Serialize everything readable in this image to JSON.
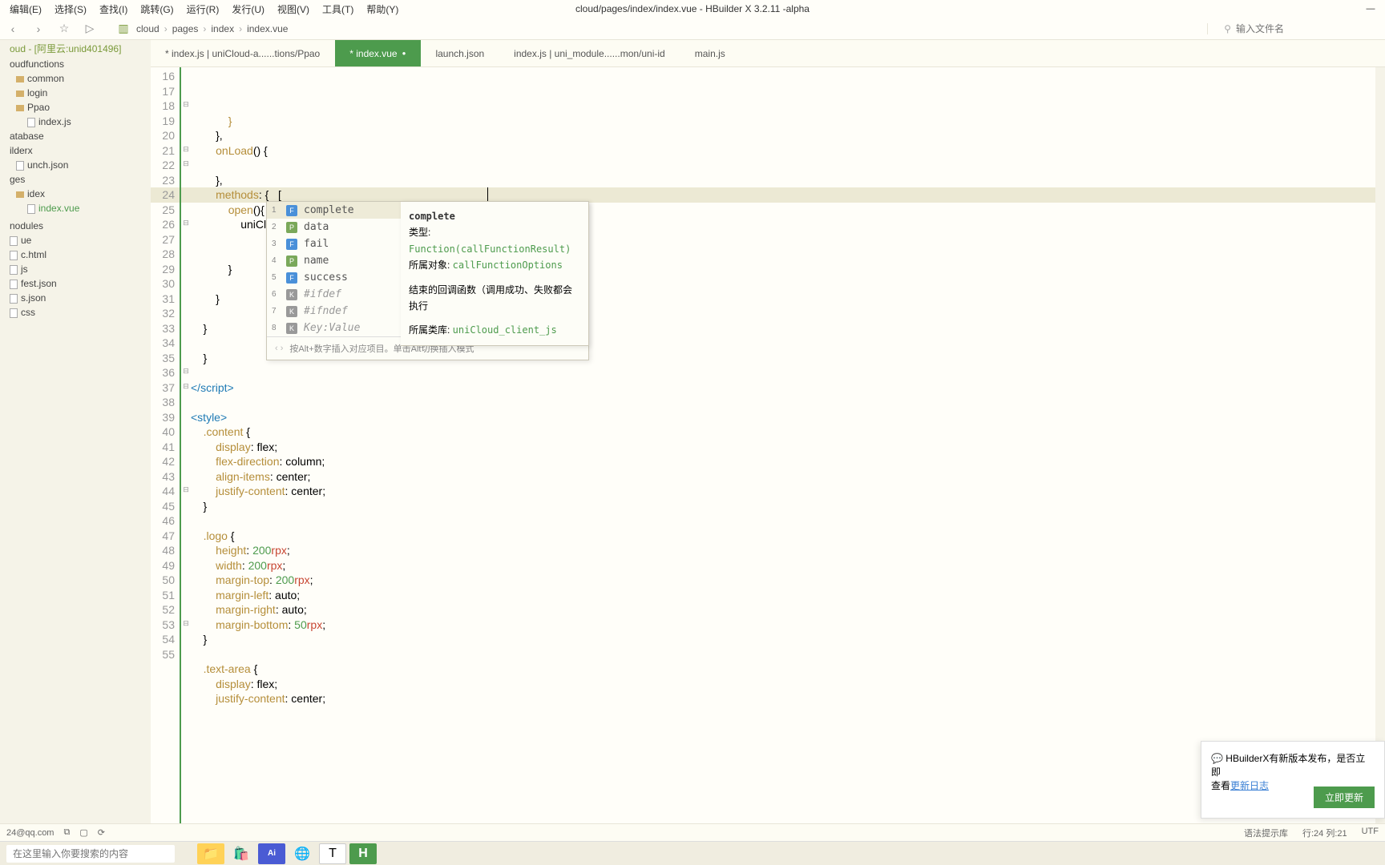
{
  "window": {
    "title": "cloud/pages/index/index.vue - HBuilder X 3.2.11 -alpha"
  },
  "menu": [
    "编辑(E)",
    "选择(S)",
    "查找(I)",
    "跳转(G)",
    "运行(R)",
    "发行(U)",
    "视图(V)",
    "工具(T)",
    "帮助(Y)"
  ],
  "search": {
    "placeholder": "输入文件名"
  },
  "breadcrumb": [
    "cloud",
    "pages",
    "index",
    "index.vue"
  ],
  "tabs": [
    {
      "label": "* index.js | uniCloud-a......tions/Ppao",
      "active": false
    },
    {
      "label": "* index.vue",
      "active": true
    },
    {
      "label": "launch.json",
      "active": false
    },
    {
      "label": "index.js | uni_module......mon/uni-id",
      "active": false
    },
    {
      "label": "main.js",
      "active": false
    }
  ],
  "sidebar": [
    {
      "label": "oud - [阿里云:unid401496]",
      "lvl": 0,
      "cls": "green"
    },
    {
      "label": "oudfunctions",
      "lvl": 0
    },
    {
      "label": "common",
      "lvl": 1,
      "icon": "folder"
    },
    {
      "label": "login",
      "lvl": 1,
      "icon": "folder"
    },
    {
      "label": "Ppao",
      "lvl": 1,
      "icon": "folder"
    },
    {
      "label": "index.js",
      "lvl": 2,
      "icon": "file"
    },
    {
      "label": "atabase",
      "lvl": 0
    },
    {
      "label": "ilderx",
      "lvl": 0
    },
    {
      "label": "unch.json",
      "lvl": 1,
      "icon": "file"
    },
    {
      "label": "ges",
      "lvl": 0
    },
    {
      "label": "idex",
      "lvl": 1,
      "icon": "folder"
    },
    {
      "label": "index.vue",
      "lvl": 2,
      "icon": "file",
      "cls": "selected"
    },
    {
      "label": "",
      "lvl": 0
    },
    {
      "label": "nodules",
      "lvl": 0
    },
    {
      "label": "ue",
      "lvl": 0,
      "icon": "file"
    },
    {
      "label": "c.html",
      "lvl": 0,
      "icon": "file"
    },
    {
      "label": "js",
      "lvl": 0,
      "icon": "file"
    },
    {
      "label": "fest.json",
      "lvl": 0,
      "icon": "file"
    },
    {
      "label": "s.json",
      "lvl": 0,
      "icon": "file"
    },
    {
      "label": "css",
      "lvl": 0,
      "icon": "file"
    }
  ],
  "code_lines": [
    {
      "n": 16,
      "html": "            <span class='c-brace1'>}</span>"
    },
    {
      "n": 17,
      "html": "        },"
    },
    {
      "n": 18,
      "html": "        <span class='c-func'>onLoad</span>() {",
      "fold": "⊟"
    },
    {
      "n": 19,
      "html": ""
    },
    {
      "n": 20,
      "html": "        },"
    },
    {
      "n": 21,
      "html": "        <span class='c-func'>methods</span>: {   <span style='color:#000'>[</span>",
      "fold": "⊟"
    },
    {
      "n": 22,
      "html": "            <span class='c-func'>open</span>(){",
      "fold": "⊟"
    },
    {
      "n": 23,
      "html": "                uniCloud.<span class='c-func'>callFunction</span>({"
    },
    {
      "n": 24,
      "html": "                    ",
      "hl": true
    },
    {
      "n": 25,
      "html": ""
    },
    {
      "n": 26,
      "html": "            }",
      "fold": "⊟"
    },
    {
      "n": 27,
      "html": ""
    },
    {
      "n": 28,
      "html": "        }"
    },
    {
      "n": 29,
      "html": ""
    },
    {
      "n": 30,
      "html": "    }"
    },
    {
      "n": 31,
      "html": ""
    },
    {
      "n": 32,
      "html": "    }"
    },
    {
      "n": 33,
      "html": ""
    },
    {
      "n": 34,
      "html": "<span class='c-tag'>&lt;/script&gt;</span>"
    },
    {
      "n": 35,
      "html": ""
    },
    {
      "n": 36,
      "html": "<span class='c-tag'>&lt;style&gt;</span>",
      "fold": "⊟"
    },
    {
      "n": 37,
      "html": "    <span class='c-sel'>.content</span> {",
      "fold": "⊟"
    },
    {
      "n": 38,
      "html": "        <span class='c-prop'>display</span>: flex;"
    },
    {
      "n": 39,
      "html": "        <span class='c-prop'>flex-direction</span>: column;"
    },
    {
      "n": 40,
      "html": "        <span class='c-prop'>align-items</span>: center;"
    },
    {
      "n": 41,
      "html": "        <span class='c-prop'>justify-content</span>: center;"
    },
    {
      "n": 42,
      "html": "    }"
    },
    {
      "n": 43,
      "html": ""
    },
    {
      "n": 44,
      "html": "    <span class='c-sel'>.logo</span> {",
      "fold": "⊟"
    },
    {
      "n": 45,
      "html": "        <span class='c-prop'>height</span>: <span class='c-num'>200</span><span class='c-red'>rpx</span>;"
    },
    {
      "n": 46,
      "html": "        <span class='c-prop'>width</span>: <span class='c-num'>200</span><span class='c-red'>rpx</span>;"
    },
    {
      "n": 47,
      "html": "        <span class='c-prop'>margin-top</span>: <span class='c-num'>200</span><span class='c-red'>rpx</span>;"
    },
    {
      "n": 48,
      "html": "        <span class='c-prop'>margin-left</span>: auto;"
    },
    {
      "n": 49,
      "html": "        <span class='c-prop'>margin-right</span>: auto;"
    },
    {
      "n": 50,
      "html": "        <span class='c-prop'>margin-bottom</span>: <span class='c-num'>50</span><span class='c-red'>rpx</span>;"
    },
    {
      "n": 51,
      "html": "    }"
    },
    {
      "n": 52,
      "html": ""
    },
    {
      "n": 53,
      "html": "    <span class='c-sel'>.text-area</span> {",
      "fold": "⊟"
    },
    {
      "n": 54,
      "html": "        <span class='c-prop'>display</span>: flex;"
    },
    {
      "n": 55,
      "html": "        <span class='c-prop'>justify-content</span>: center;"
    }
  ],
  "autocomplete": {
    "items": [
      {
        "n": "1",
        "icon": "f",
        "label": "complete",
        "sel": true
      },
      {
        "n": "2",
        "icon": "p",
        "label": "data"
      },
      {
        "n": "3",
        "icon": "f",
        "label": "fail"
      },
      {
        "n": "4",
        "icon": "p",
        "label": "name"
      },
      {
        "n": "5",
        "icon": "f",
        "label": "success"
      },
      {
        "n": "6",
        "icon": "k",
        "label": "#ifdef",
        "gray": true
      },
      {
        "n": "7",
        "icon": "k",
        "label": "#ifndef",
        "gray": true
      },
      {
        "n": "8",
        "icon": "k",
        "label": "Key:Value",
        "gray": true
      }
    ],
    "hint": "按Alt+数字插入对应项目。单击Alt切换插入模式",
    "detail": {
      "title": "complete",
      "type_label": "类型: ",
      "type_value": "Function(callFunctionResult)",
      "owner_label": "所属对象: ",
      "owner_value": "callFunctionOptions",
      "desc": "结束的回调函数（调用成功、失败都会执行",
      "lib_label": "所属类库: ",
      "lib_value": "uniCloud_client_js"
    }
  },
  "statusbar": {
    "email": "24@qq.com",
    "syntax": "语法提示库",
    "pos": "行:24  列:21",
    "enc": "UTF"
  },
  "notification": {
    "text": "HBuilderX有新版本发布，是否立即",
    "link_prefix": "查看",
    "link": "更新日志",
    "button": "立即更新"
  },
  "taskbar": {
    "search_placeholder": "在这里输入你要搜索的内容"
  }
}
